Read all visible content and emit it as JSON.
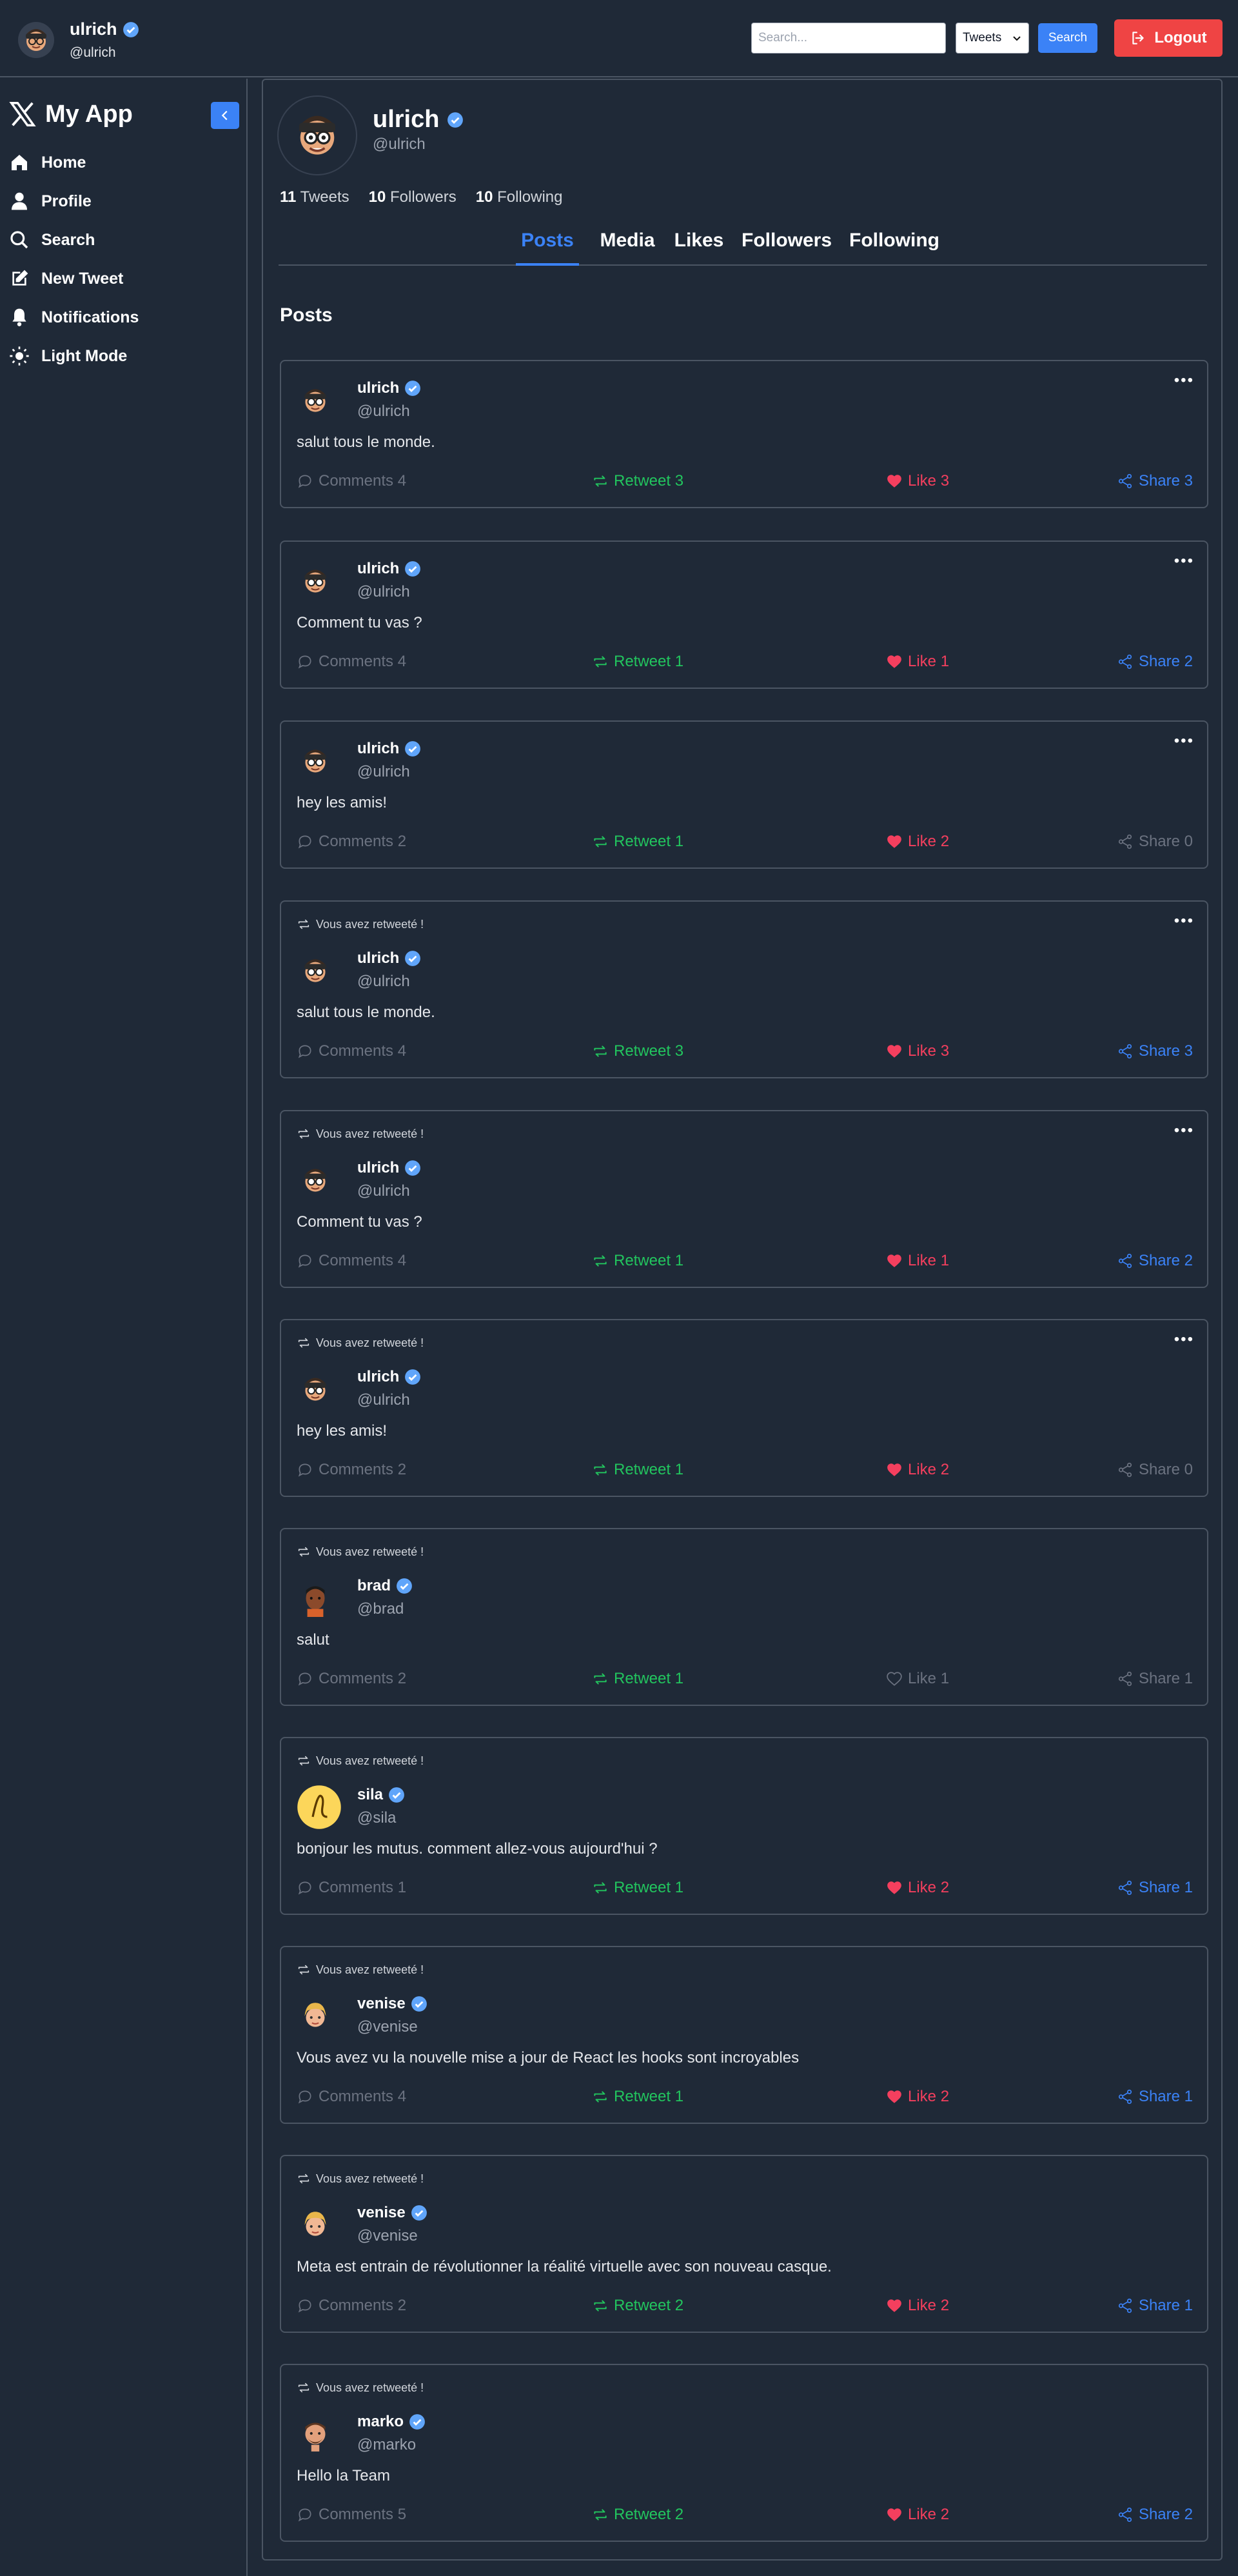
{
  "header": {
    "user_name": "ulrich",
    "user_handle": "@ulrich",
    "search_placeholder": "Search...",
    "search_type": "Tweets",
    "search_button": "Search",
    "logout_label": "Logout"
  },
  "sidebar": {
    "brand": "My App",
    "items": [
      {
        "label": "Home",
        "icon": "home-icon"
      },
      {
        "label": "Profile",
        "icon": "user-icon"
      },
      {
        "label": "Search",
        "icon": "search-icon"
      },
      {
        "label": "New Tweet",
        "icon": "edit-icon"
      },
      {
        "label": "Notifications",
        "icon": "bell-icon"
      },
      {
        "label": "Light Mode",
        "icon": "sun-icon"
      }
    ]
  },
  "profile": {
    "name": "ulrich",
    "handle": "@ulrich",
    "tweets_count": "11",
    "tweets_label": "Tweets",
    "followers_count": "10",
    "followers_label": "Followers",
    "following_count": "10",
    "following_label": "Following"
  },
  "tabs": [
    "Posts",
    "Media",
    "Likes",
    "Followers",
    "Following"
  ],
  "active_tab": "Posts",
  "section_title": "Posts",
  "colors": {
    "background": "#1f2937",
    "border": "#4b5563",
    "accent": "#3b82f6",
    "logout": "#ef4444",
    "retweet": "#22c55e",
    "like": "#f43f5e",
    "muted": "#6b7280"
  },
  "posts": [
    {
      "retweet_note": "",
      "author": "ulrich",
      "handle": "@ulrich",
      "avatar": "memoji-glasses",
      "text": "salut tous le monde.",
      "comments": "Comments 4",
      "retweet": "Retweet 3",
      "like": "Like 3",
      "share": "Share 3",
      "liked": true,
      "shared": true,
      "has_menu": true
    },
    {
      "retweet_note": "",
      "author": "ulrich",
      "handle": "@ulrich",
      "avatar": "memoji-glasses",
      "text": "Comment tu vas ?",
      "comments": "Comments 4",
      "retweet": "Retweet 1",
      "like": "Like 1",
      "share": "Share 2",
      "liked": true,
      "shared": true,
      "has_menu": true
    },
    {
      "retweet_note": "",
      "author": "ulrich",
      "handle": "@ulrich",
      "avatar": "memoji-glasses",
      "text": "hey les amis!",
      "comments": "Comments 2",
      "retweet": "Retweet 1",
      "like": "Like 2",
      "share": "Share 0",
      "liked": true,
      "shared": false,
      "has_menu": true
    },
    {
      "retweet_note": "Vous avez retweeté !",
      "author": "ulrich",
      "handle": "@ulrich",
      "avatar": "memoji-glasses",
      "text": "salut tous le monde.",
      "comments": "Comments 4",
      "retweet": "Retweet 3",
      "like": "Like 3",
      "share": "Share 3",
      "liked": true,
      "shared": true,
      "has_menu": true
    },
    {
      "retweet_note": "Vous avez retweeté !",
      "author": "ulrich",
      "handle": "@ulrich",
      "avatar": "memoji-glasses",
      "text": "Comment tu vas ?",
      "comments": "Comments 4",
      "retweet": "Retweet 1",
      "like": "Like 1",
      "share": "Share 2",
      "liked": true,
      "shared": true,
      "has_menu": true
    },
    {
      "retweet_note": "Vous avez retweeté !",
      "author": "ulrich",
      "handle": "@ulrich",
      "avatar": "memoji-glasses",
      "text": "hey les amis!",
      "comments": "Comments 2",
      "retweet": "Retweet 1",
      "like": "Like 2",
      "share": "Share 0",
      "liked": true,
      "shared": false,
      "has_menu": true
    },
    {
      "retweet_note": "Vous avez retweeté !",
      "author": "brad",
      "handle": "@brad",
      "avatar": "memoji-dark",
      "text": "salut",
      "comments": "Comments 2",
      "retweet": "Retweet 1",
      "like": "Like 1",
      "share": "Share 1",
      "liked": false,
      "shared": false,
      "has_menu": false
    },
    {
      "retweet_note": "Vous avez retweeté !",
      "author": "sila",
      "handle": "@sila",
      "avatar": "yellow-logo",
      "text": "bonjour les mutus. comment allez-vous aujourd'hui ?",
      "comments": "Comments 1",
      "retweet": "Retweet 1",
      "like": "Like 2",
      "share": "Share 1",
      "liked": true,
      "shared": true,
      "has_menu": false
    },
    {
      "retweet_note": "Vous avez retweeté !",
      "author": "venise",
      "handle": "@venise",
      "avatar": "memoji-blonde",
      "text": "Vous avez vu la nouvelle mise a jour de React les hooks sont incroyables",
      "comments": "Comments 4",
      "retweet": "Retweet 1",
      "like": "Like 2",
      "share": "Share 1",
      "liked": true,
      "shared": true,
      "has_menu": false
    },
    {
      "retweet_note": "Vous avez retweeté !",
      "author": "venise",
      "handle": "@venise",
      "avatar": "memoji-blonde",
      "text": "Meta est entrain de révolutionner la réalité virtuelle avec son nouveau casque.",
      "comments": "Comments 2",
      "retweet": "Retweet 2",
      "like": "Like 2",
      "share": "Share 1",
      "liked": true,
      "shared": true,
      "has_menu": false
    },
    {
      "retweet_note": "Vous avez retweeté !",
      "author": "marko",
      "handle": "@marko",
      "avatar": "memoji-beard",
      "text": "Hello la Team",
      "comments": "Comments 5",
      "retweet": "Retweet 2",
      "like": "Like 2",
      "share": "Share 2",
      "liked": true,
      "shared": true,
      "has_menu": false
    }
  ]
}
